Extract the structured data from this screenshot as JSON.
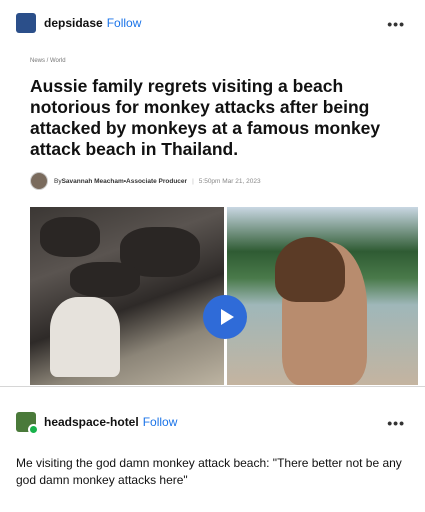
{
  "post1": {
    "username": "depsidase",
    "follow_label": "Follow",
    "more_label": "•••"
  },
  "article": {
    "breadcrumb": "News / World",
    "headline": "Aussie family regrets visiting a beach notorious for monkey attacks after being attacked by monkeys at a famous monkey attack beach in Thailand.",
    "byline_prefix": "By ",
    "author": "Savannah Meacham",
    "role_sep": " • ",
    "role": "Associate Producer",
    "separator": "|",
    "timestamp": "5:50pm Mar 21, 2023"
  },
  "post2": {
    "username": "headspace-hotel",
    "follow_label": "Follow",
    "more_label": "•••",
    "text": "Me visiting the god damn monkey attack beach: \"There better not be any god damn monkey attacks here\""
  },
  "icons": {
    "play": "play-icon",
    "more": "more-horizontal-icon",
    "badge": "online-badge-icon"
  },
  "colors": {
    "follow": "#1a73e8",
    "play_button": "#2f6bd8",
    "badge": "#17b24a"
  }
}
